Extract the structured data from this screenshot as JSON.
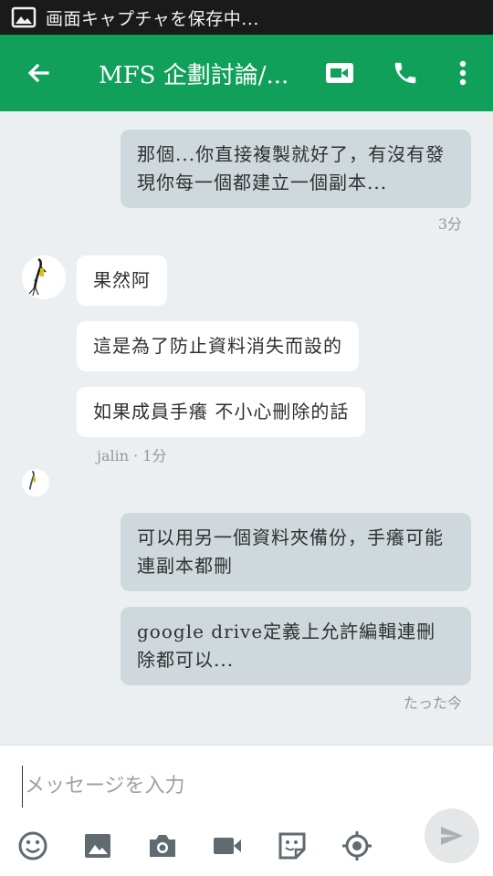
{
  "status_bar": {
    "text": "画面キャプチャを保存中...",
    "icon": "image-icon"
  },
  "header": {
    "title": "MFS 企劃討論/...",
    "icons": [
      "back-arrow-icon",
      "video-call-icon",
      "phone-icon",
      "more-vert-icon"
    ]
  },
  "messages": {
    "m1": "那個...你直接複製就好了，有沒有發現你每一個都建立一個副本...",
    "m1_time": "3分",
    "m2": "果然阿",
    "m3": "這是為了防止資料消失而設的",
    "m4": "如果成員手癢 不小心刪除的話",
    "m4_meta": "jalin · 1分",
    "m5": "可以用另一個資料夾備份，手癢可能連副本都刪",
    "m6": "google drive定義上允許編輯連刪除都可以...",
    "m6_time": "たった今"
  },
  "composer": {
    "placeholder": "メッセージを入力",
    "tools": [
      "emoji-icon",
      "image-icon",
      "camera-icon",
      "video-icon",
      "sticker-icon",
      "location-icon",
      "send-icon"
    ]
  },
  "colors": {
    "accent": "#11a05a",
    "outgoing_bubble": "#cfd8dc",
    "background": "#eceff1"
  }
}
